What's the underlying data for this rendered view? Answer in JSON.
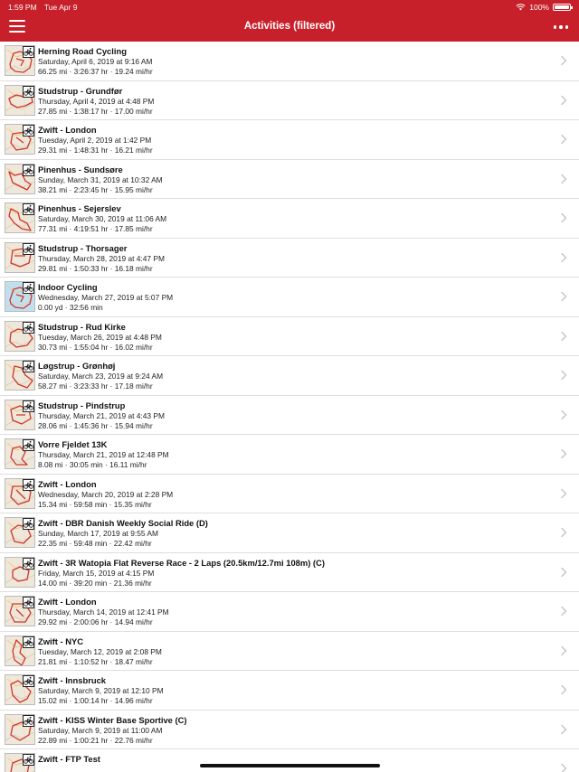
{
  "status_bar": {
    "time": "1:59 PM",
    "date": "Tue Apr 9",
    "battery": "100%"
  },
  "header": {
    "title": "Activities (filtered)"
  },
  "activities": [
    {
      "title": "Herning Road Cycling",
      "date": "Saturday, April 6, 2019 at 9:16 AM",
      "stats": "66.25 mi · 3:26:37 hr · 19.24 mi/hr"
    },
    {
      "title": "Studstrup - Grundfør",
      "date": "Thursday, April 4, 2019 at 4:48 PM",
      "stats": "27.85 mi · 1:38:17 hr · 17.00 mi/hr"
    },
    {
      "title": "Zwift - London",
      "date": "Tuesday, April 2, 2019 at 1:42 PM",
      "stats": "29.31 mi · 1:48:31 hr · 16.21 mi/hr"
    },
    {
      "title": "Pinenhus - Sundsøre",
      "date": "Sunday, March 31, 2019 at 10:32 AM",
      "stats": "38.21 mi · 2:23:45 hr · 15.95 mi/hr"
    },
    {
      "title": "Pinenhus - Sejerslev",
      "date": "Saturday, March 30, 2019 at 11:06 AM",
      "stats": "77.31 mi · 4:19:51 hr · 17.85 mi/hr"
    },
    {
      "title": "Studstrup - Thorsager",
      "date": "Thursday, March 28, 2019 at 4:47 PM",
      "stats": "29.81 mi · 1:50:33 hr · 16.18 mi/hr"
    },
    {
      "title": "Indoor Cycling",
      "date": "Wednesday, March 27, 2019 at 5:07 PM",
      "stats": "0.00 yd · 32:56 min"
    },
    {
      "title": "Studstrup - Rud Kirke",
      "date": "Tuesday, March 26, 2019 at 4:48 PM",
      "stats": "30.73 mi · 1:55:04 hr · 16.02 mi/hr"
    },
    {
      "title": "Løgstrup - Grønhøj",
      "date": "Saturday, March 23, 2019 at 9:24 AM",
      "stats": "58.27 mi · 3:23:33 hr · 17.18 mi/hr"
    },
    {
      "title": "Studstrup - Pindstrup",
      "date": "Thursday, March 21, 2019 at 4:43 PM",
      "stats": "28.06 mi · 1:45:36 hr · 15.94 mi/hr"
    },
    {
      "title": "Vorre Fjeldet 13K",
      "date": "Thursday, March 21, 2019 at 12:48 PM",
      "stats": "8.08 mi · 30:05 min · 16.11 mi/hr"
    },
    {
      "title": "Zwift - London",
      "date": "Wednesday, March 20, 2019 at 2:28 PM",
      "stats": "15.34 mi · 59:58 min · 15.35 mi/hr"
    },
    {
      "title": "Zwift - DBR Danish Weekly Social Ride  (D)",
      "date": "Sunday, March 17, 2019 at 9:55 AM",
      "stats": "22.35 mi · 59:48 min · 22.42 mi/hr"
    },
    {
      "title": "Zwift - 3R Watopia Flat Reverse Race - 2 Laps (20.5km/12.7mi 108m) (C)",
      "date": "Friday, March 15, 2019 at 4:15 PM",
      "stats": "14.00 mi · 39:20 min · 21.36 mi/hr"
    },
    {
      "title": "Zwift - London",
      "date": "Thursday, March 14, 2019 at 12:41 PM",
      "stats": "29.92 mi · 2:00:06 hr · 14.94 mi/hr"
    },
    {
      "title": "Zwift - NYC",
      "date": "Tuesday, March 12, 2019 at 2:08 PM",
      "stats": "21.81 mi · 1:10:52 hr · 18.47 mi/hr"
    },
    {
      "title": "Zwift - Innsbruck",
      "date": "Saturday, March 9, 2019 at 12:10 PM",
      "stats": "15.02 mi · 1:00:14 hr · 14.96 mi/hr"
    },
    {
      "title": "Zwift - KISS Winter Base Sportive (C)",
      "date": "Saturday, March 9, 2019 at 11:00 AM",
      "stats": "22.89 mi · 1:00:21 hr · 22.76 mi/hr"
    },
    {
      "title": "Zwift - FTP Test",
      "date": "",
      "stats": ""
    }
  ],
  "icons": {
    "menu": "hamburger-menu-icon",
    "more": "more-options-icon",
    "row_badge": "bicycle-icon",
    "row_action": "chevron-right-icon"
  },
  "colors": {
    "header_bg": "#c8202a",
    "route_line": "#d0342c",
    "map_bg": "#efe8da",
    "water": "#bfe0f0"
  }
}
